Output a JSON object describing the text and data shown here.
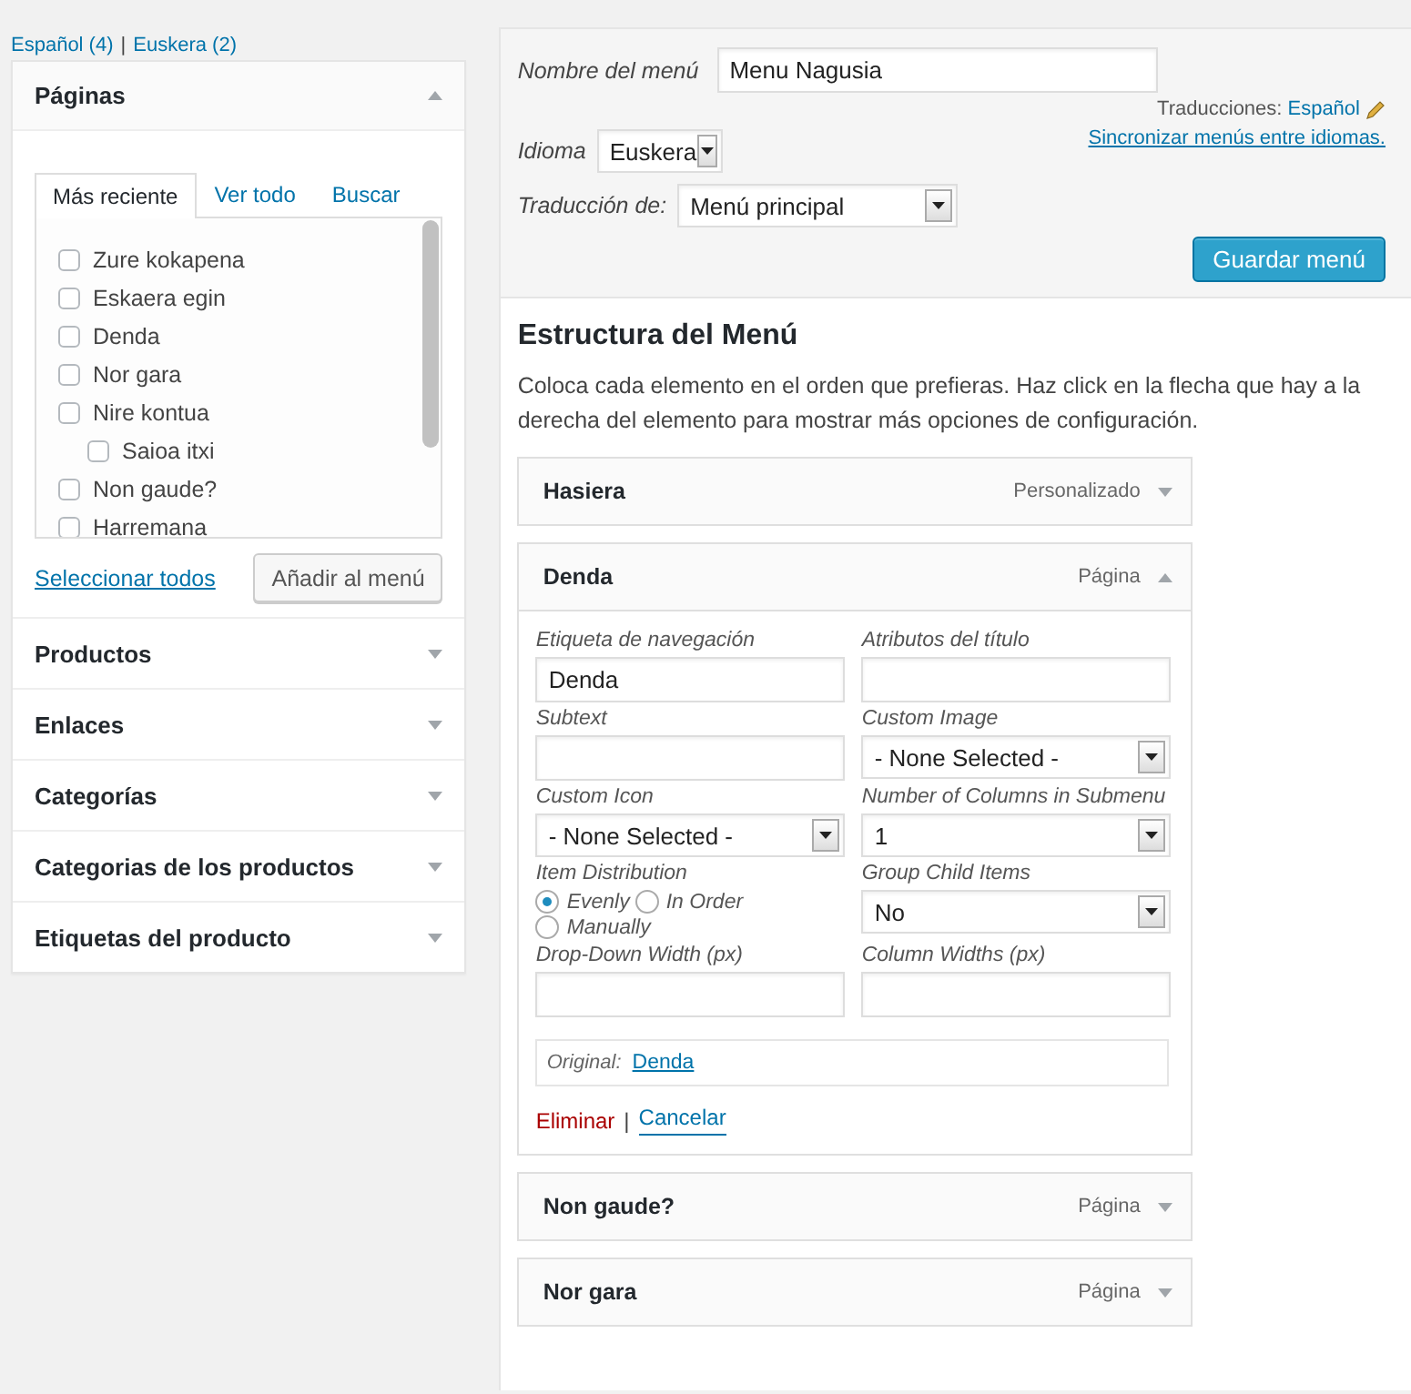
{
  "language_links": [
    {
      "label": "Español (4)"
    },
    {
      "label": "Euskera (2)"
    }
  ],
  "language_separator": "|",
  "sidebar": {
    "panels": [
      {
        "title": "Páginas",
        "expanded": true,
        "tabs": [
          {
            "label": "Más reciente",
            "selected": true
          },
          {
            "label": "Ver todo",
            "selected": false
          },
          {
            "label": "Buscar",
            "selected": false
          }
        ],
        "items": [
          {
            "label": "Zure kokapena",
            "checked": false
          },
          {
            "label": "Eskaera egin",
            "checked": false
          },
          {
            "label": "Denda",
            "checked": false
          },
          {
            "label": "Nor gara",
            "checked": false
          },
          {
            "label": "Nire kontua",
            "checked": false,
            "children": [
              {
                "label": "Saioa itxi",
                "checked": false
              }
            ]
          },
          {
            "label": "Non gaude?",
            "checked": false
          },
          {
            "label": "Harremana",
            "checked": false
          }
        ],
        "select_all": "Seleccionar todos",
        "add_button": "Añadir al menú"
      },
      {
        "title": "Productos",
        "expanded": false
      },
      {
        "title": "Enlaces",
        "expanded": false
      },
      {
        "title": "Categorías",
        "expanded": false
      },
      {
        "title": "Categorias de los productos",
        "expanded": false
      },
      {
        "title": "Etiquetas del producto",
        "expanded": false
      }
    ]
  },
  "menu_settings": {
    "name_label": "Nombre del menú",
    "name_value": "Menu Nagusia",
    "translations_label": "Traducciones:",
    "translations_link": "Español",
    "sync_link": "Sincronizar menús entre idiomas.",
    "language_label": "Idioma",
    "language_value": "Euskera",
    "translation_of_label": "Traducción de:",
    "translation_of_value": "Menú principal",
    "save_button": "Guardar menú"
  },
  "structure": {
    "title": "Estructura del Menú",
    "description": "Coloca cada elemento en el orden que prefieras. Haz click en la flecha que hay a la derecha del elemento para mostrar más opciones de configuración.",
    "items": [
      {
        "title": "Hasiera",
        "type": "Personalizado",
        "expanded": false
      },
      {
        "title": "Denda",
        "type": "Página",
        "expanded": true,
        "fields": [
          {
            "kind": "text",
            "label": "Etiqueta de navegación",
            "value": "Denda"
          },
          {
            "kind": "text",
            "label": "Atributos del título"
          },
          {
            "kind": "text",
            "label": "Subtext"
          },
          {
            "kind": "select",
            "label": "Custom Image",
            "value": "- None Selected -"
          },
          {
            "kind": "select",
            "label": "Custom Icon",
            "value": "- None Selected -"
          },
          {
            "kind": "select",
            "label": "Number of Columns in Submenu",
            "value": "1"
          },
          {
            "kind": "radio",
            "label": "Item Distribution",
            "options": [
              {
                "label": "Evenly",
                "selected": true
              },
              {
                "label": "In Order",
                "selected": false
              },
              {
                "label": "Manually",
                "selected": false
              }
            ]
          },
          {
            "kind": "select",
            "label": "Group Child Items",
            "value": "No"
          },
          {
            "kind": "text",
            "label": "Drop-Down Width (px)"
          },
          {
            "kind": "text",
            "label": "Column Widths (px)"
          }
        ],
        "original_label": "Original:",
        "original_link": "Denda",
        "remove_link": "Eliminar",
        "action_separator": "|",
        "cancel_link": "Cancelar"
      },
      {
        "title": "Non gaude?",
        "type": "Página",
        "expanded": false
      },
      {
        "title": "Nor gara",
        "type": "Página",
        "expanded": false
      }
    ]
  }
}
